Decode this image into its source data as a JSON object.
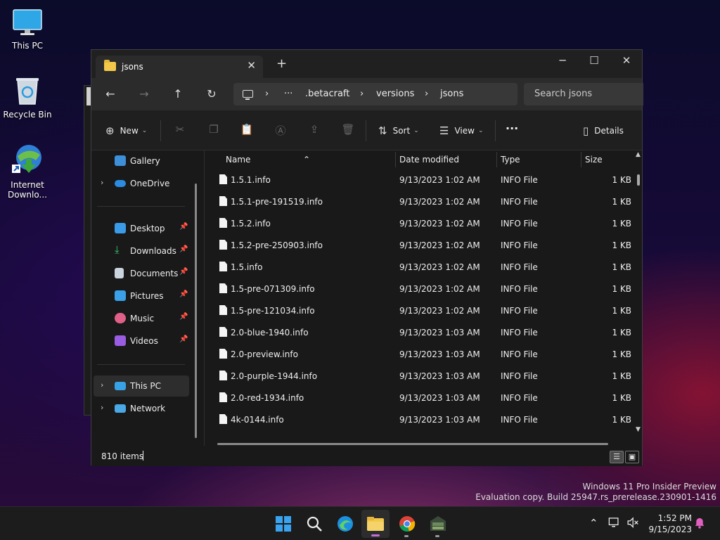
{
  "desktop": {
    "icons": [
      {
        "label": "This PC"
      },
      {
        "label": "Recycle Bin"
      },
      {
        "label": "Internet Downlo..."
      }
    ]
  },
  "window": {
    "tab_title": "jsons",
    "new_tab": "+",
    "controls": {
      "minimize": "─",
      "maximize": "☐",
      "close": "✕"
    },
    "breadcrumb": {
      "ellipsis": "···",
      "items": [
        ".betacraft",
        "versions",
        "jsons"
      ]
    },
    "search_placeholder": "Search jsons",
    "toolbar": {
      "new_label": "New",
      "sort_label": "Sort",
      "view_label": "View",
      "more_label": "···",
      "details_label": "Details"
    },
    "nav": {
      "gallery": "Gallery",
      "onedrive": "OneDrive",
      "desktop": "Desktop",
      "downloads": "Downloads",
      "documents": "Documents",
      "pictures": "Pictures",
      "music": "Music",
      "videos": "Videos",
      "this_pc": "This PC",
      "network": "Network"
    },
    "columns": {
      "name": "Name",
      "date": "Date modified",
      "type": "Type",
      "size": "Size"
    },
    "files": [
      {
        "name": "1.5.1.info",
        "date": "9/13/2023 1:02 AM",
        "type": "INFO File",
        "size": "1 KB"
      },
      {
        "name": "1.5.1-pre-191519.info",
        "date": "9/13/2023 1:02 AM",
        "type": "INFO File",
        "size": "1 KB"
      },
      {
        "name": "1.5.2.info",
        "date": "9/13/2023 1:02 AM",
        "type": "INFO File",
        "size": "1 KB"
      },
      {
        "name": "1.5.2-pre-250903.info",
        "date": "9/13/2023 1:02 AM",
        "type": "INFO File",
        "size": "1 KB"
      },
      {
        "name": "1.5.info",
        "date": "9/13/2023 1:02 AM",
        "type": "INFO File",
        "size": "1 KB"
      },
      {
        "name": "1.5-pre-071309.info",
        "date": "9/13/2023 1:02 AM",
        "type": "INFO File",
        "size": "1 KB"
      },
      {
        "name": "1.5-pre-121034.info",
        "date": "9/13/2023 1:02 AM",
        "type": "INFO File",
        "size": "1 KB"
      },
      {
        "name": "2.0-blue-1940.info",
        "date": "9/13/2023 1:03 AM",
        "type": "INFO File",
        "size": "1 KB"
      },
      {
        "name": "2.0-preview.info",
        "date": "9/13/2023 1:03 AM",
        "type": "INFO File",
        "size": "1 KB"
      },
      {
        "name": "2.0-purple-1944.info",
        "date": "9/13/2023 1:03 AM",
        "type": "INFO File",
        "size": "1 KB"
      },
      {
        "name": "2.0-red-1934.info",
        "date": "9/13/2023 1:03 AM",
        "type": "INFO File",
        "size": "1 KB"
      },
      {
        "name": "4k-0144.info",
        "date": "9/13/2023 1:03 AM",
        "type": "INFO File",
        "size": "1 KB"
      }
    ],
    "status_count": "810 items"
  },
  "watermark": {
    "line1": "Windows 11 Pro Insider Preview",
    "line2": "Evaluation copy. Build 25947.rs_prerelease.230901-1416"
  },
  "taskbar": {
    "time": "1:52 PM",
    "date": "9/15/2023"
  },
  "colors": {
    "folder": "#f3c74a",
    "window_bg": "#191919",
    "taskbar_bg": "#1c1c1c",
    "accent": "#0078d4"
  }
}
